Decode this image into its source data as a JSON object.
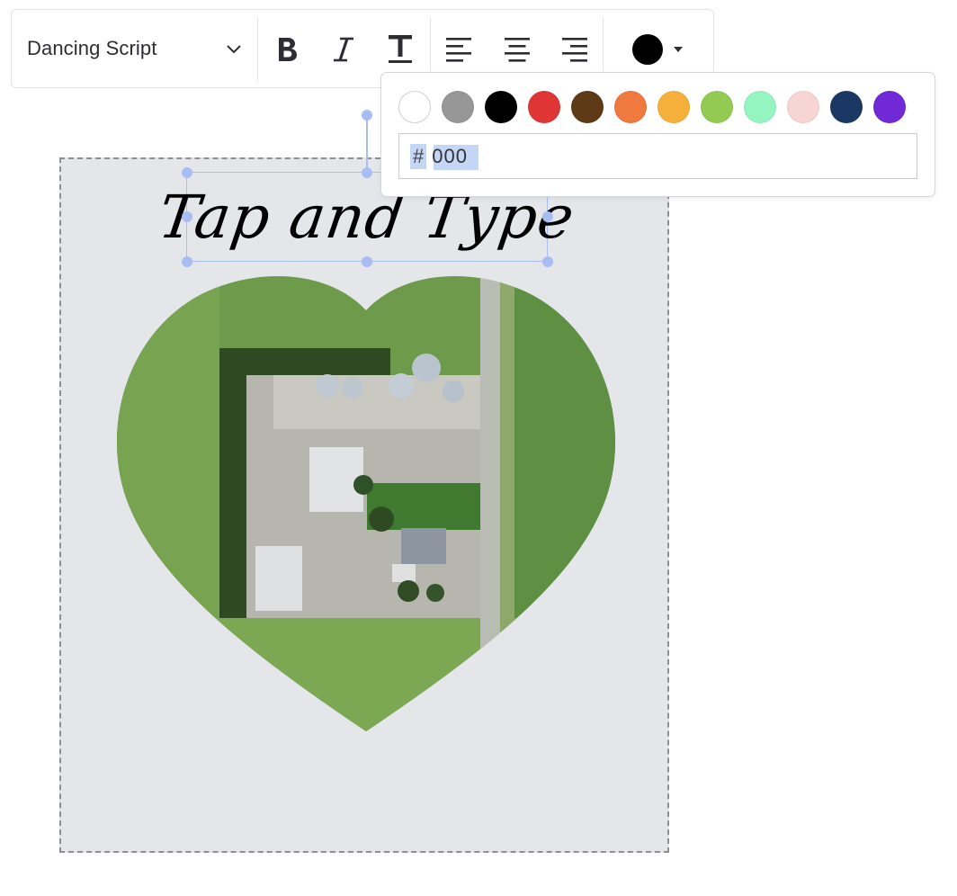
{
  "toolbar": {
    "font_family": "Dancing Script",
    "icons": {
      "font_dropdown": "chevron-down-icon",
      "bold": "bold-icon",
      "italic": "italic-icon",
      "text_style": "text-style-icon",
      "align_left": "align-left-icon",
      "align_center": "align-center-icon",
      "align_right": "align-right-icon",
      "color": "text-color-icon"
    },
    "current_color": "#000000"
  },
  "canvas": {
    "text_element": "Tap and Type",
    "image": "aerial-farm-heart-image"
  },
  "color_picker": {
    "swatches": [
      "#ffffff",
      "#979797",
      "#000000",
      "#e03535",
      "#5e3a17",
      "#f07940",
      "#f5b03b",
      "#93cb52",
      "#95f5c1",
      "#f7d5d3",
      "#1b3763",
      "#7128d6"
    ],
    "hex_prefix": "#",
    "hex_value": "000"
  }
}
